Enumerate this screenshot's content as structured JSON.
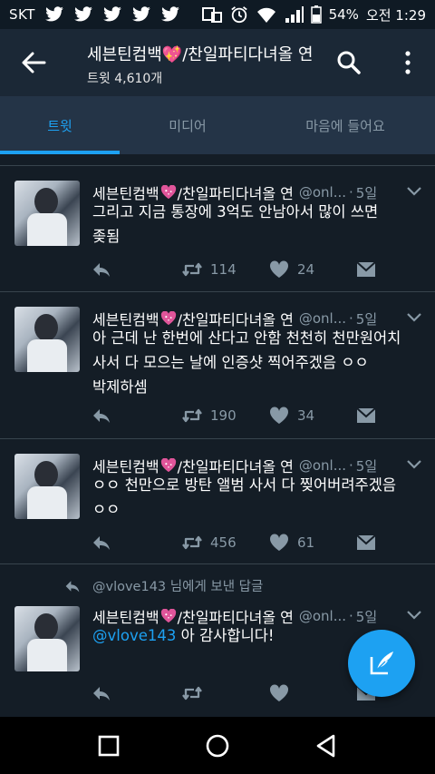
{
  "status_bar": {
    "carrier": "SKT",
    "battery": "54%",
    "time": "오전 1:29"
  },
  "app_bar": {
    "title": "세븐틴컴백💖/찬일파티다녀올 연",
    "subtitle": "트윗 4,610개"
  },
  "tabs": [
    {
      "label": "트윗",
      "active": true
    },
    {
      "label": "미디어",
      "active": false
    },
    {
      "label": "마음에 들어요",
      "active": false
    }
  ],
  "tweets": [
    {
      "name_a": "세븐틴컴백",
      "name_b": "/찬일파티다녀올 연",
      "handle": "@onl...",
      "date": "5일",
      "line1": "그리고 지금 통장에 3억도 안남아서 많이 쓰면",
      "line2": "좆됨",
      "retweets": "114",
      "likes": "24"
    },
    {
      "name_a": "세븐틴컴백",
      "name_b": "/찬일파티다녀올 연",
      "handle": "@onl...",
      "date": "5일",
      "line1": "아 근데 난 한번에 산다고 안함 천천히 천만원어치",
      "line2": "사서 다 모으는 날에 인증샷 찍어주겠음 ㅇㅇ",
      "line3": "박제하셈",
      "retweets": "190",
      "likes": "34"
    },
    {
      "name_a": "세븐틴컴백",
      "name_b": "/찬일파티다녀올 연",
      "handle": "@onl...",
      "date": "5일",
      "line1": "ㅇㅇ 천만으로 방탄 앨범 사서 다 찢어버려주겠음",
      "line2": "ㅇㅇ",
      "retweets": "456",
      "likes": "61"
    },
    {
      "reply_context": "@vlove143 님에게 보낸 답글",
      "name_a": "세븐틴컴백",
      "name_b": "/찬일파티다녀올 연",
      "handle": "@onl...",
      "date": "5일",
      "mention": "@vlove143",
      "text_rest": " 아 감사합니다!",
      "retweets": "",
      "likes": ""
    }
  ],
  "colors": {
    "accent": "#1da1f2",
    "background": "#141d26",
    "app_bar": "#1b2836",
    "tab_bar": "#243447",
    "muted_text": "#8899a6",
    "emoji_heart": "#e0559a"
  }
}
